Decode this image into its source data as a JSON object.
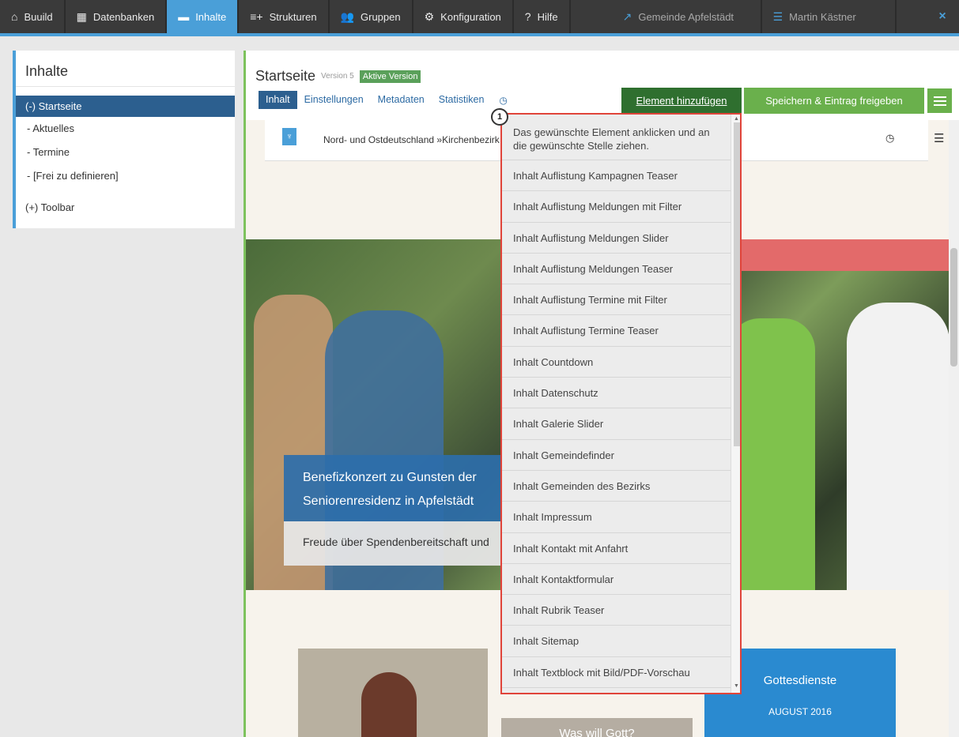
{
  "topnav": {
    "items": [
      {
        "label": "Buuild",
        "icon": "home-icon"
      },
      {
        "label": "Datenbanken",
        "icon": "calendar-icon"
      },
      {
        "label": "Inhalte",
        "icon": "folder-icon"
      },
      {
        "label": "Strukturen",
        "icon": "structure-icon"
      },
      {
        "label": "Gruppen",
        "icon": "users-icon"
      },
      {
        "label": "Konfiguration",
        "icon": "gear-icon"
      },
      {
        "label": "Hilfe",
        "icon": "help-icon"
      }
    ],
    "community": "Gemeinde Apfelstädt",
    "user": "Martin Kästner",
    "close": "×"
  },
  "sidebar": {
    "title": "Inhalte",
    "items": [
      {
        "label": "(-) Startseite"
      },
      {
        "label": "- Aktuelles"
      },
      {
        "label": "- Termine"
      },
      {
        "label": "- [Frei zu definieren]"
      },
      {
        "label": "(+) Toolbar"
      }
    ]
  },
  "main": {
    "title": "Startseite",
    "version": "Version 5",
    "badge": "Aktive Version",
    "tabs": [
      {
        "label": "Inhalt"
      },
      {
        "label": "Einstellungen"
      },
      {
        "label": "Metadaten"
      },
      {
        "label": "Statistiken"
      }
    ],
    "add_button": "Element hinzufügen",
    "save_button": "Speichern & Eintrag freigeben"
  },
  "preview": {
    "breadcrumb": "Nord- und Ostdeutschland »Kirchenbezirk Go",
    "hero_title": "Benefizkonzert zu Gunsten der Seniorenresidenz in Apfelstädt",
    "hero_sub": "Freude über Spendenbereitschaft und",
    "card2": "Was will Gott?",
    "card3_title": "Gottesdienste",
    "card3_sub": "AUGUST 2016"
  },
  "dropdown": {
    "marker": "1",
    "hint": "Das gewünschte Element anklicken und an die gewünschte Stelle ziehen.",
    "items": [
      "Inhalt Auflistung Kampagnen Teaser",
      "Inhalt Auflistung Meldungen mit Filter",
      "Inhalt Auflistung Meldungen Slider",
      "Inhalt Auflistung Meldungen Teaser",
      "Inhalt Auflistung Termine mit Filter",
      "Inhalt Auflistung Termine Teaser",
      "Inhalt Countdown",
      "Inhalt Datenschutz",
      "Inhalt Galerie Slider",
      "Inhalt Gemeindefinder",
      "Inhalt Gemeinden des Bezirks",
      "Inhalt Impressum",
      "Inhalt Kontakt mit Anfahrt",
      "Inhalt Kontaktformular",
      "Inhalt Rubrik Teaser",
      "Inhalt Sitemap",
      "Inhalt Textblock mit Bild/PDF-Vorschau"
    ]
  },
  "colors": {
    "accent": "#4a9fd8",
    "nav_bg": "#3a3a3a",
    "add_btn": "#2f6f2f",
    "save_btn": "#6ab04c",
    "highlight_border": "#e0443a"
  }
}
